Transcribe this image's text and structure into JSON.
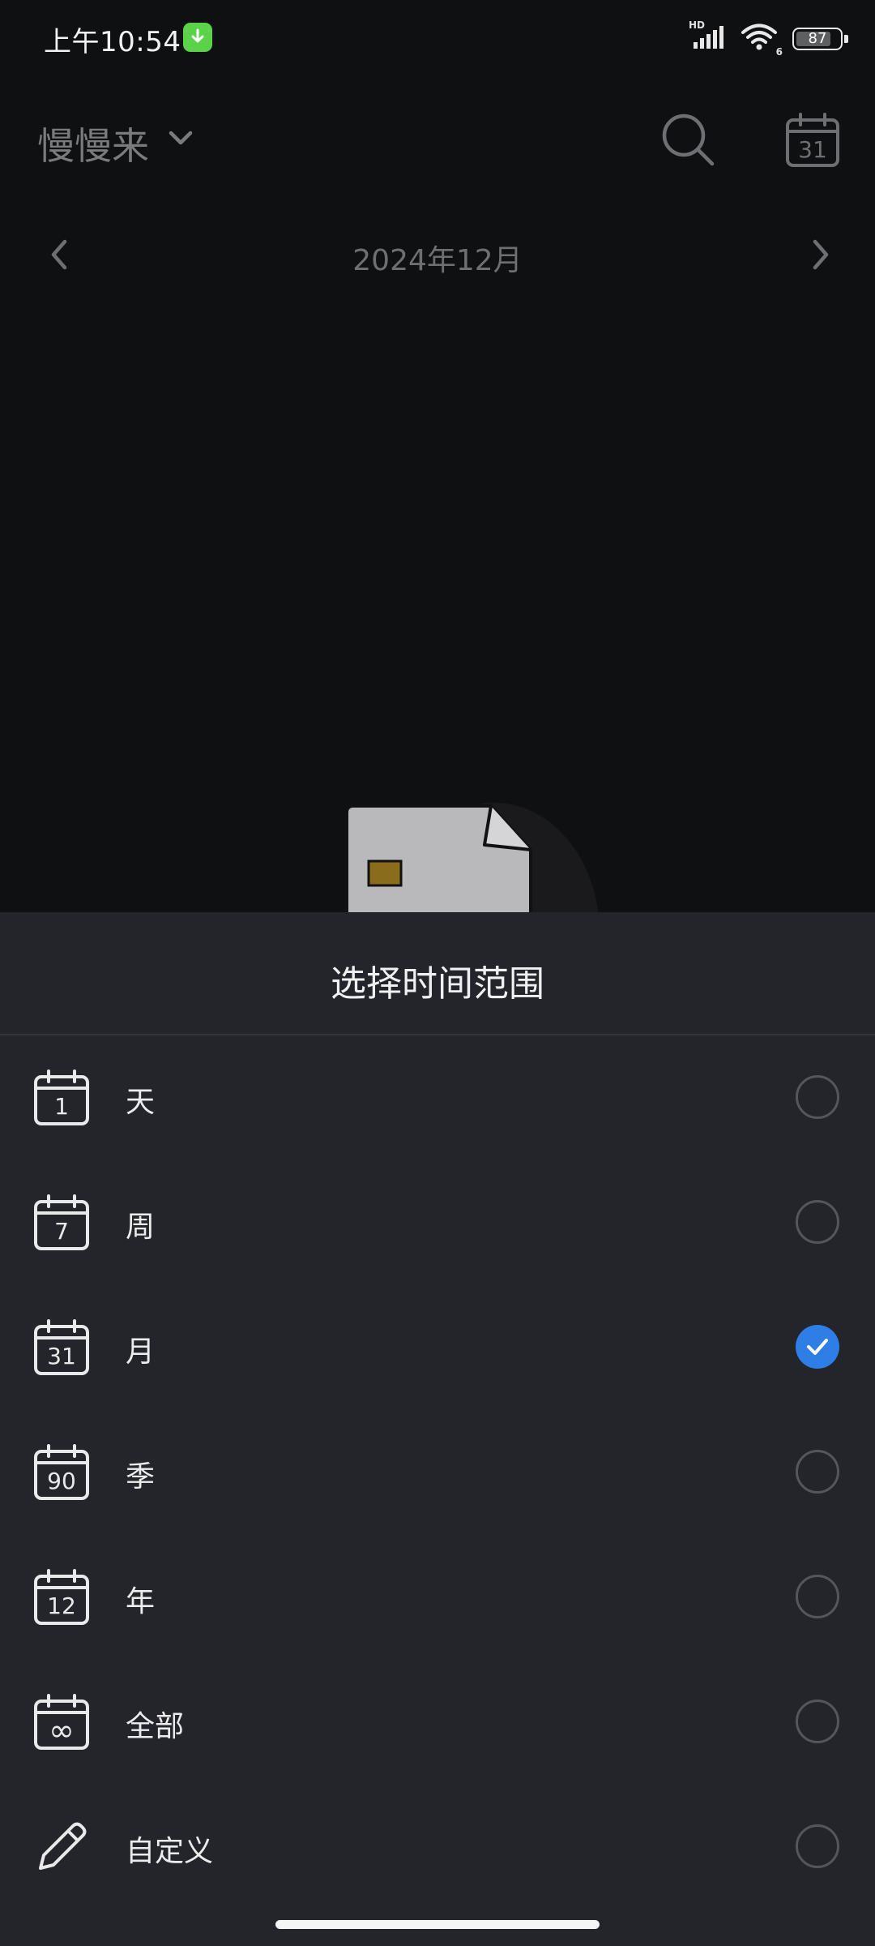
{
  "status_bar": {
    "time": "上午10:54",
    "network": "HD",
    "wifi_band": "6",
    "battery": "87"
  },
  "header": {
    "account": "慢慢来",
    "calendar_day": "31"
  },
  "month_nav": {
    "label": "2024年12月"
  },
  "sheet": {
    "title": "选择时间范围",
    "options": [
      {
        "label": "天",
        "icon_text": "1",
        "checked": false
      },
      {
        "label": "周",
        "icon_text": "7",
        "checked": false
      },
      {
        "label": "月",
        "icon_text": "31",
        "checked": true
      },
      {
        "label": "季",
        "icon_text": "90",
        "checked": false
      },
      {
        "label": "年",
        "icon_text": "12",
        "checked": false
      },
      {
        "label": "全部",
        "icon_text": "∞",
        "checked": false
      },
      {
        "label": "自定义",
        "icon_text": "",
        "checked": false
      }
    ]
  },
  "colors": {
    "accent": "#2f7ee6",
    "sheet_bg": "#24252a",
    "page_bg": "#0f1012"
  }
}
